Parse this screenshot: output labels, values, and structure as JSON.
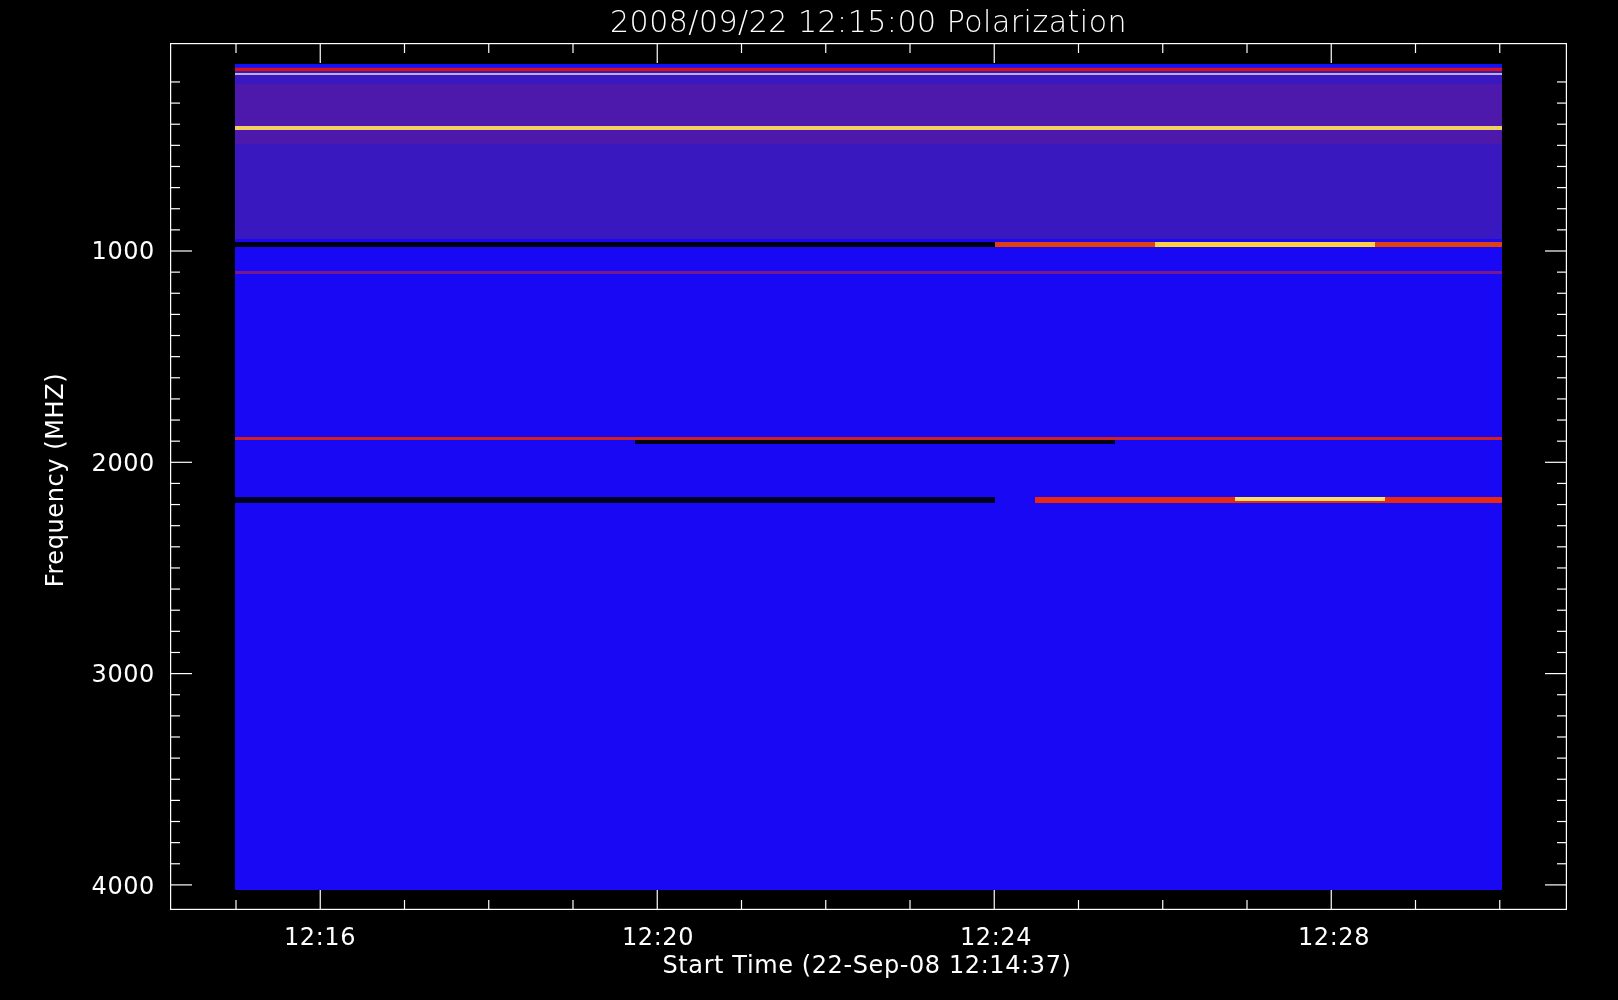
{
  "title": "2008/09/22 12:15:00 Polarization",
  "y_axis": {
    "label": "Frequency (MHZ)",
    "ticks": [
      "1000",
      "2000",
      "3000",
      "4000"
    ]
  },
  "x_axis": {
    "label": "Start Time (22-Sep-08 12:14:37)",
    "ticks": [
      "12:16",
      "12:20",
      "12:24",
      "12:28"
    ]
  }
}
